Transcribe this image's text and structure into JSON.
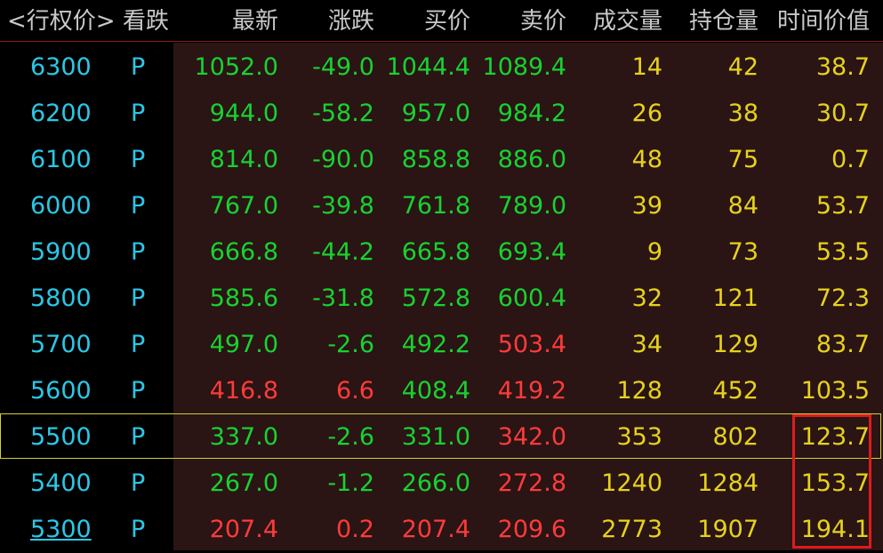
{
  "header": {
    "strike": "<行权价>",
    "type": "看跌",
    "last": "最新",
    "change": "涨跌",
    "bid": "买价",
    "ask": "卖价",
    "volume": "成交量",
    "open_interest": "持仓量",
    "time_value": "时间价值"
  },
  "colors": {
    "up": "#ff3b3b",
    "down": "#18d230",
    "neutral": "#e6d21c",
    "strike": "#2bc7e6",
    "selected_border": "#d4cf3a",
    "annotation_box": "#e01b1b"
  },
  "rows": [
    {
      "strike": "6300",
      "type": "P",
      "last": "1052.0",
      "last_color": "green",
      "change": "-49.0",
      "change_color": "green",
      "bid": "1044.4",
      "bid_color": "green",
      "ask": "1089.4",
      "ask_color": "green",
      "volume": "14",
      "open_interest": "42",
      "time_value": "38.7"
    },
    {
      "strike": "6200",
      "type": "P",
      "last": "944.0",
      "last_color": "green",
      "change": "-58.2",
      "change_color": "green",
      "bid": "957.0",
      "bid_color": "green",
      "ask": "984.2",
      "ask_color": "green",
      "volume": "26",
      "open_interest": "38",
      "time_value": "30.7"
    },
    {
      "strike": "6100",
      "type": "P",
      "last": "814.0",
      "last_color": "green",
      "change": "-90.0",
      "change_color": "green",
      "bid": "858.8",
      "bid_color": "green",
      "ask": "886.0",
      "ask_color": "green",
      "volume": "48",
      "open_interest": "75",
      "time_value": "0.7"
    },
    {
      "strike": "6000",
      "type": "P",
      "last": "767.0",
      "last_color": "green",
      "change": "-39.8",
      "change_color": "green",
      "bid": "761.8",
      "bid_color": "green",
      "ask": "789.0",
      "ask_color": "green",
      "volume": "39",
      "open_interest": "84",
      "time_value": "53.7"
    },
    {
      "strike": "5900",
      "type": "P",
      "last": "666.8",
      "last_color": "green",
      "change": "-44.2",
      "change_color": "green",
      "bid": "665.8",
      "bid_color": "green",
      "ask": "693.4",
      "ask_color": "green",
      "volume": "9",
      "open_interest": "73",
      "time_value": "53.5"
    },
    {
      "strike": "5800",
      "type": "P",
      "last": "585.6",
      "last_color": "green",
      "change": "-31.8",
      "change_color": "green",
      "bid": "572.8",
      "bid_color": "green",
      "ask": "600.4",
      "ask_color": "green",
      "volume": "32",
      "open_interest": "121",
      "time_value": "72.3"
    },
    {
      "strike": "5700",
      "type": "P",
      "last": "497.0",
      "last_color": "green",
      "change": "-2.6",
      "change_color": "green",
      "bid": "492.2",
      "bid_color": "green",
      "ask": "503.4",
      "ask_color": "red",
      "volume": "34",
      "open_interest": "129",
      "time_value": "83.7"
    },
    {
      "strike": "5600",
      "type": "P",
      "last": "416.8",
      "last_color": "red",
      "change": "6.6",
      "change_color": "red",
      "bid": "408.4",
      "bid_color": "green",
      "ask": "419.2",
      "ask_color": "red",
      "volume": "128",
      "open_interest": "452",
      "time_value": "103.5"
    },
    {
      "strike": "5500",
      "type": "P",
      "last": "337.0",
      "last_color": "green",
      "change": "-2.6",
      "change_color": "green",
      "bid": "331.0",
      "bid_color": "green",
      "ask": "342.0",
      "ask_color": "red",
      "volume": "353",
      "open_interest": "802",
      "time_value": "123.7"
    },
    {
      "strike": "5400",
      "type": "P",
      "last": "267.0",
      "last_color": "green",
      "change": "-1.2",
      "change_color": "green",
      "bid": "266.0",
      "bid_color": "green",
      "ask": "272.8",
      "ask_color": "red",
      "volume": "1240",
      "open_interest": "1284",
      "time_value": "153.7"
    },
    {
      "strike": "5300",
      "type": "P",
      "last": "207.4",
      "last_color": "red",
      "change": "0.2",
      "change_color": "red",
      "bid": "207.4",
      "bid_color": "red",
      "ask": "209.6",
      "ask_color": "red",
      "volume": "2773",
      "open_interest": "1907",
      "time_value": "194.1"
    }
  ]
}
